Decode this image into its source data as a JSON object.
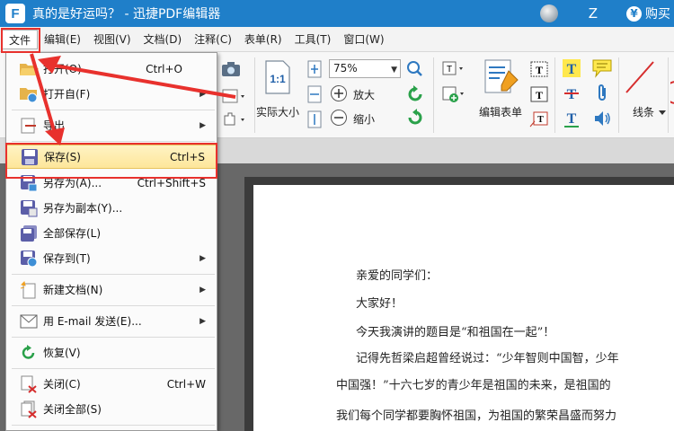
{
  "window": {
    "title": "真的是好运吗？ - 迅捷PDF编辑器",
    "user_letter": "Z",
    "buy_label": "购买",
    "logo_letter": "F"
  },
  "menubar": {
    "items": [
      "文件",
      "编辑(E)",
      "视图(V)",
      "文档(D)",
      "注释(C)",
      "表单(R)",
      "工具(T)",
      "窗口(W)"
    ]
  },
  "toolbar": {
    "actual_size_label": "实际大小",
    "actual_size_icon_text": "1:1",
    "zoom_value": "75%",
    "zoom_in_label": "放大",
    "zoom_out_label": "缩小",
    "edit_form_label": "编辑表单",
    "lines_label": "线条",
    "text_tool_letter": "T"
  },
  "file_menu": {
    "items": [
      {
        "label": "打开(O)",
        "shortcut": "Ctrl+O",
        "icon": "folder-open-icon",
        "submenu": false
      },
      {
        "label": "打开自(F)",
        "shortcut": "",
        "icon": "folder-globe-icon",
        "submenu": true
      },
      {
        "label": "导出",
        "shortcut": "",
        "icon": "export-icon",
        "submenu": true
      },
      {
        "label": "保存(S)",
        "shortcut": "Ctrl+S",
        "icon": "save-icon",
        "submenu": false
      },
      {
        "label": "另存为(A)...",
        "shortcut": "Ctrl+Shift+S",
        "icon": "save-as-icon",
        "submenu": false
      },
      {
        "label": "另存为副本(Y)...",
        "shortcut": "",
        "icon": "save-copy-icon",
        "submenu": false
      },
      {
        "label": "全部保存(L)",
        "shortcut": "",
        "icon": "save-all-icon",
        "submenu": false
      },
      {
        "label": "保存到(T)",
        "shortcut": "",
        "icon": "save-to-icon",
        "submenu": true
      },
      {
        "label": "新建文档(N)",
        "shortcut": "",
        "icon": "new-document-icon",
        "submenu": true
      },
      {
        "label": "用 E-mail 发送(E)...",
        "shortcut": "",
        "icon": "email-icon",
        "submenu": true
      },
      {
        "label": "恢复(V)",
        "shortcut": "",
        "icon": "restore-icon",
        "submenu": false
      },
      {
        "label": "关闭(C)",
        "shortcut": "Ctrl+W",
        "icon": "close-doc-icon",
        "submenu": false
      },
      {
        "label": "关闭全部(S)",
        "shortcut": "",
        "icon": "close-all-icon",
        "submenu": false
      }
    ]
  },
  "document": {
    "lines": [
      "亲爱的同学们：",
      "大家好！",
      "今天我演讲的题目是“和祖国在一起”！",
      "记得先哲梁启超曾经说过：“少年智则中国智，少年",
      "中国强！”十六七岁的青少年是祖国的未来，是祖国的",
      "我们每个同学都要胸怀祖国，为祖国的繁荣昌盛而努力"
    ]
  },
  "colors": {
    "titlebar": "#1f7fc9",
    "highlight_annotation": "#e8312d",
    "menu_highlight": "#fde69a"
  }
}
